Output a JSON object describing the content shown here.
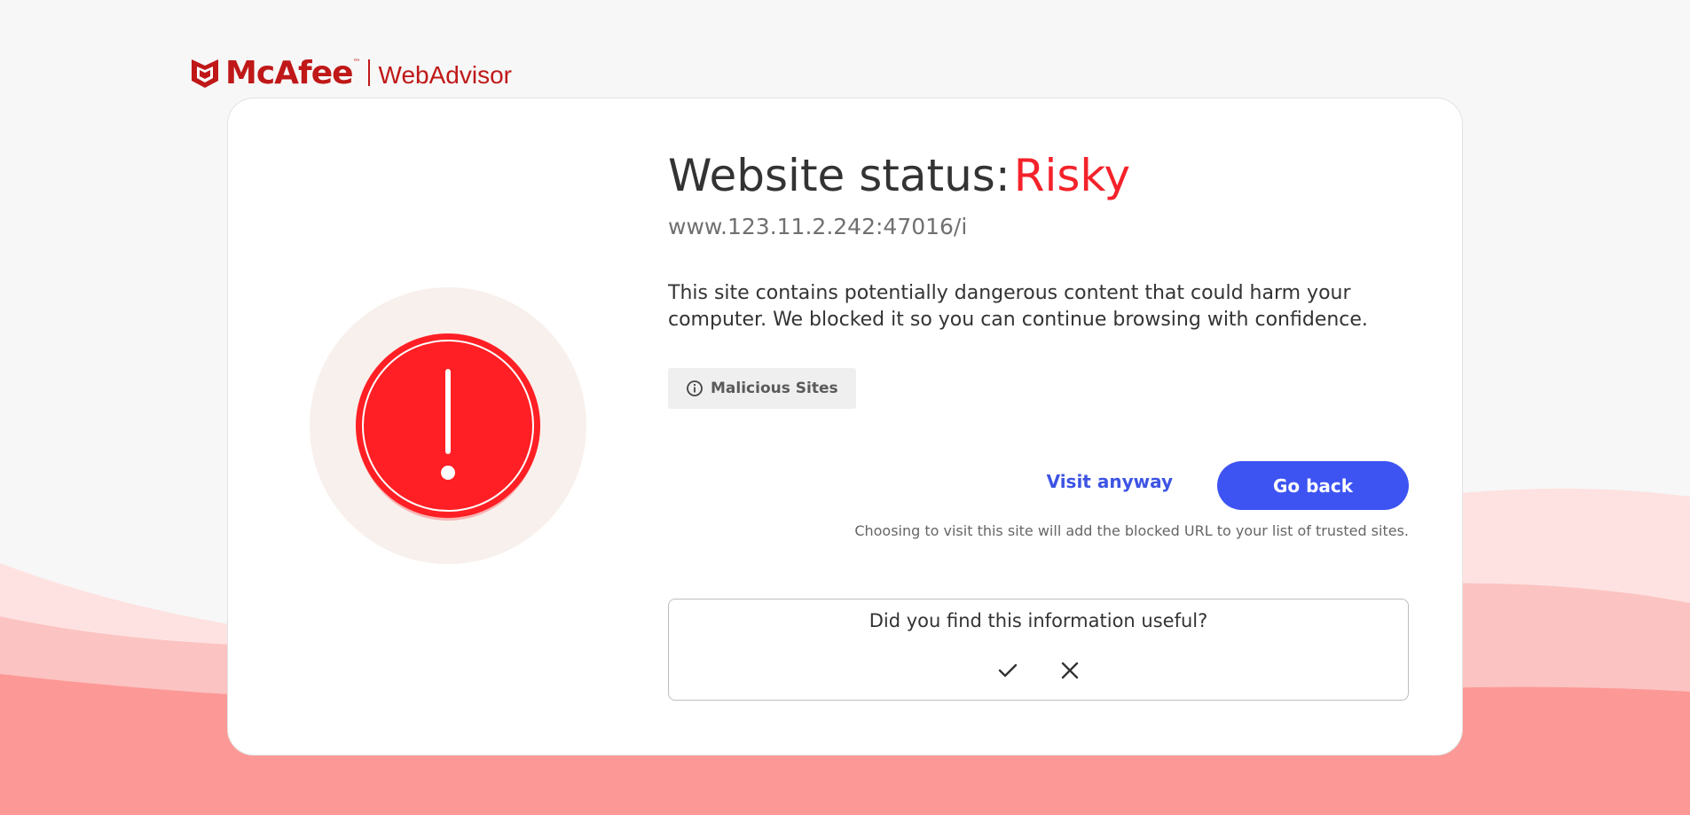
{
  "logo": {
    "brand": "McAfee",
    "trademark": "™",
    "product": "WebAdvisor",
    "icon": "mcafee-shield-icon"
  },
  "status": {
    "title_prefix": "Website status:",
    "value": "Risky",
    "url": "www.123.11.2.242:47016/i",
    "description": "This site contains potentially dangerous content that could harm your computer. We blocked it so you can continue browsing with confidence.",
    "alert_icon": "exclamation-icon"
  },
  "tag": {
    "label": "Malicious Sites",
    "icon": "info-icon"
  },
  "actions": {
    "visit_label": "Visit anyway",
    "goback_label": "Go back",
    "note": "Choosing to visit this site will add the blocked URL to your list of trusted sites."
  },
  "feedback": {
    "question": "Did you find this information useful?",
    "yes_icon": "checkmark-icon",
    "no_icon": "close-icon"
  },
  "colors": {
    "brand": "#c01818",
    "risky": "#f4222a",
    "primary": "#3d54f2",
    "alert": "#ff1f24",
    "wave": "#fc9896"
  }
}
